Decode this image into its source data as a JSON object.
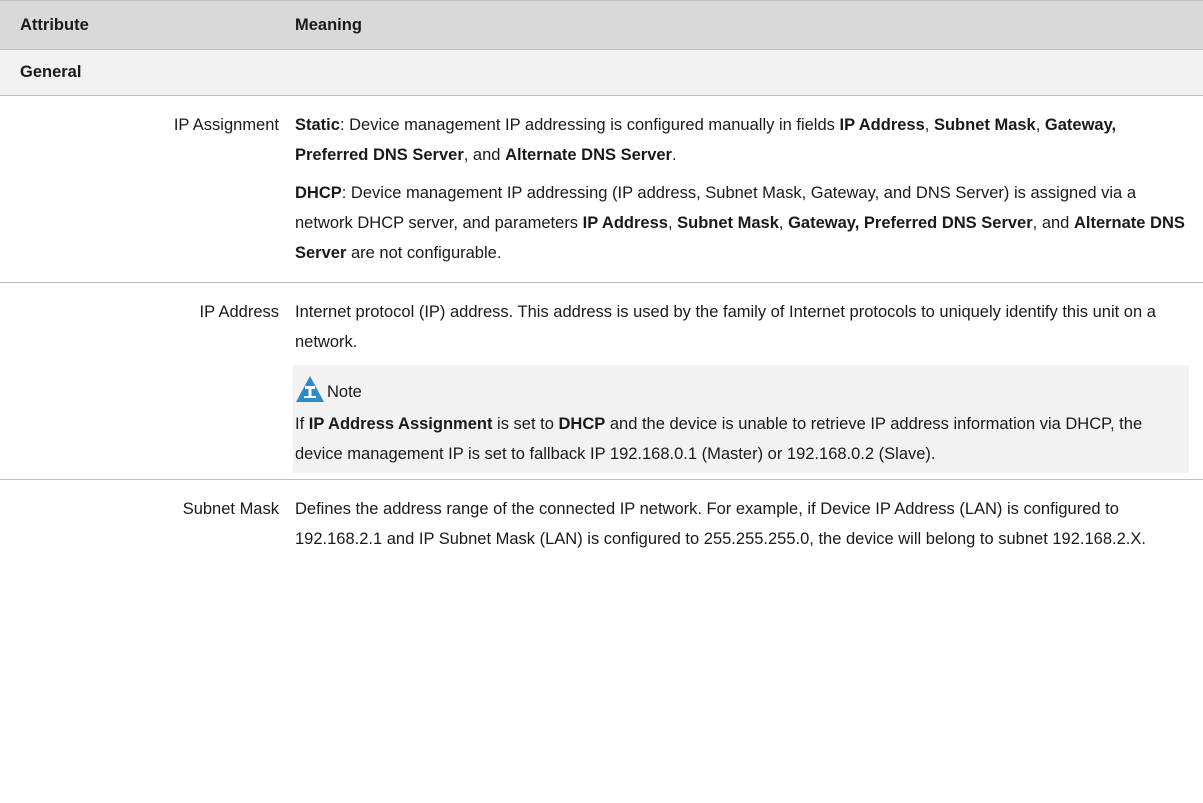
{
  "table": {
    "headers": {
      "attribute": "Attribute",
      "meaning": "Meaning"
    },
    "section": "General",
    "rows": {
      "ip_assignment": {
        "attribute": "IP Assignment",
        "static": {
          "label": "Static",
          "t1": ":  Device management IP addressing is configured manually in fields ",
          "b1": "IP Address",
          "t2": ", ",
          "b2": "Subnet Mask",
          "t3": ", ",
          "b3": "Gateway, Preferred DNS Server",
          "t4": ", and ",
          "b4": "Alternate DNS Server",
          "t5": "."
        },
        "dhcp": {
          "label": "DHCP",
          "t1": ":  Device management IP addressing (IP address, Subnet Mask, Gateway, and DNS Server) is assigned via a network DHCP server, and parameters ",
          "b1": "IP Address",
          "t2": ", ",
          "b2": "Subnet Mask",
          "t3": ", ",
          "b3": "Gateway, Preferred DNS Server",
          "t4": ", and ",
          "b4": "Alternate DNS Server",
          "t5": " are not configurable."
        }
      },
      "ip_address": {
        "attribute": "IP Address",
        "description": "Internet protocol (IP) address. This address is used by the family of Internet protocols to uniquely identify this unit on a network.",
        "note": {
          "icon": "note-icon",
          "title": "Note",
          "t1": "If ",
          "b1": "IP Address Assignment",
          "t2": " is set to ",
          "b2": "DHCP",
          "t3": " and the device is unable to retrieve IP address information via DHCP, the device management IP is set to fallback IP 192.168.0.1 (Master) or 192.168.0.2 (Slave)."
        }
      },
      "subnet_mask": {
        "attribute": "Subnet Mask",
        "description": "Defines the address range of the connected IP network. For example, if Device IP Address (LAN) is configured to 192.168.2.1 and IP Subnet Mask (LAN) is configured to 255.255.255.0, the device will belong to subnet 192.168.2.X."
      }
    }
  },
  "colors": {
    "header_bg": "#d9d9d9",
    "section_bg": "#f2f2f2",
    "note_bg": "#f2f2f2",
    "border": "#bfbfbf",
    "icon_blue": "#2e8bc9"
  }
}
